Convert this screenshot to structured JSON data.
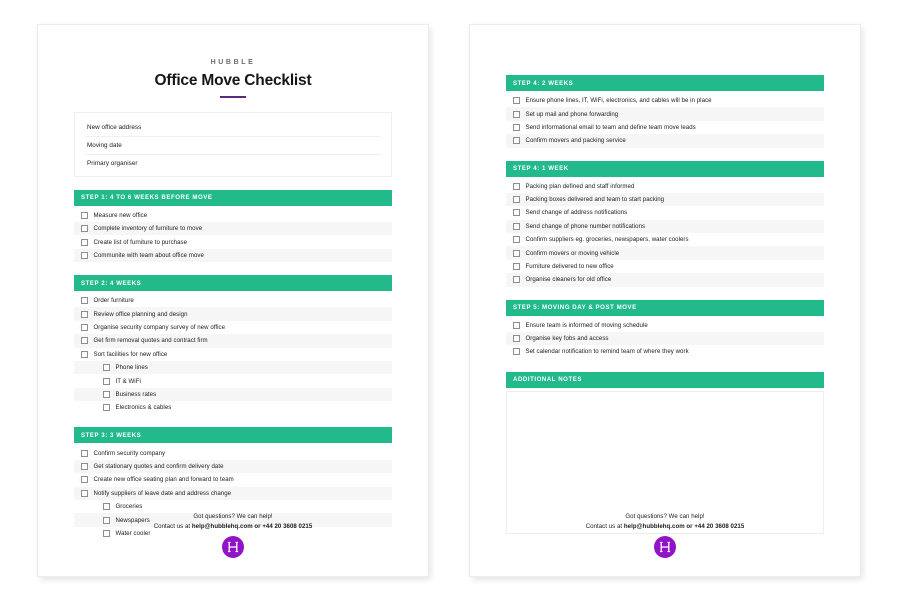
{
  "document": {
    "brand": "HUBBLE",
    "title": "Office Move Checklist"
  },
  "details": {
    "fields": [
      {
        "label": "New office address"
      },
      {
        "label": "Moving date"
      },
      {
        "label": "Primary organiser"
      }
    ]
  },
  "footer": {
    "line1": "Got questions? We can help!",
    "line2_prefix": "Contact us at ",
    "line2_contact": "help@hubblehq.com or +44 20 3608 0215",
    "logo_letter": "H"
  },
  "left_page": {
    "sections": [
      {
        "heading": "STEP 1: 4 TO 6 WEEKS BEFORE MOVE",
        "items": [
          {
            "label": "Measure new office",
            "sub": false
          },
          {
            "label": "Complete inventory of furniture to move",
            "sub": false
          },
          {
            "label": "Create list of furniture to purchase",
            "sub": false
          },
          {
            "label": "Communite with team about office move",
            "sub": false
          }
        ]
      },
      {
        "heading": "STEP 2: 4 WEEKS",
        "items": [
          {
            "label": "Order furniture",
            "sub": false
          },
          {
            "label": "Review office planning and design",
            "sub": false
          },
          {
            "label": "Organise security company survey of new office",
            "sub": false
          },
          {
            "label": "Get firm removal quotes and contract firm",
            "sub": false
          },
          {
            "label": "Sort facilities for new office",
            "sub": false
          },
          {
            "label": "Phone lines",
            "sub": true
          },
          {
            "label": "IT & WiFi",
            "sub": true
          },
          {
            "label": "Business rates",
            "sub": true
          },
          {
            "label": "Electronics & cables",
            "sub": true
          }
        ]
      },
      {
        "heading": "STEP 3: 3 WEEKS",
        "items": [
          {
            "label": "Confirm security company",
            "sub": false
          },
          {
            "label": "Get stationary quotes and confirm delivery date",
            "sub": false
          },
          {
            "label": "Create new office seating plan and forward to team",
            "sub": false
          },
          {
            "label": "Notify suppliers of leave date and address change",
            "sub": false
          },
          {
            "label": "Groceries",
            "sub": true
          },
          {
            "label": "Newspapers",
            "sub": true
          },
          {
            "label": "Water cooler",
            "sub": true
          }
        ]
      }
    ]
  },
  "right_page": {
    "sections": [
      {
        "heading": "STEP 4: 2 WEEKS",
        "items": [
          {
            "label": "Ensure phone lines, IT, WiFi, electronics, and cables will be in place",
            "sub": false
          },
          {
            "label": "Set up mail and phone forwarding",
            "sub": false
          },
          {
            "label": "Send informational email to team and define team move leads",
            "sub": false
          },
          {
            "label": "Confirm movers and packing service",
            "sub": false
          }
        ]
      },
      {
        "heading": "STEP 4: 1 WEEK",
        "items": [
          {
            "label": "Packing plan defined and staff informed",
            "sub": false
          },
          {
            "label": "Packing boxes delivered and team to start packing",
            "sub": false
          },
          {
            "label": "Send change of address notifications",
            "sub": false
          },
          {
            "label": "Send change of phone number notifications",
            "sub": false
          },
          {
            "label": "Confirm suppliers eg. groceries, newspapers, water coolers",
            "sub": false
          },
          {
            "label": "Confirm movers or moving vehicle",
            "sub": false
          },
          {
            "label": "Furniture delivered to new office",
            "sub": false
          },
          {
            "label": "Organise cleaners for old office",
            "sub": false
          }
        ]
      },
      {
        "heading": "STEP 5: MOVING DAY & POST MOVE",
        "items": [
          {
            "label": "Ensure team is informed of moving schedule",
            "sub": false
          },
          {
            "label": "Organise key fobs and access",
            "sub": false
          },
          {
            "label": "Set calendar notification to remind team of where they work",
            "sub": false
          }
        ]
      }
    ],
    "notes": {
      "heading": "ADDITIONAL NOTES",
      "content": ""
    }
  },
  "colors": {
    "section_green": "#22b98b",
    "logo_purple": "#9013c7",
    "title_rule_purple": "#5b2b7b",
    "zebra_gray": "#f6f6f6"
  }
}
